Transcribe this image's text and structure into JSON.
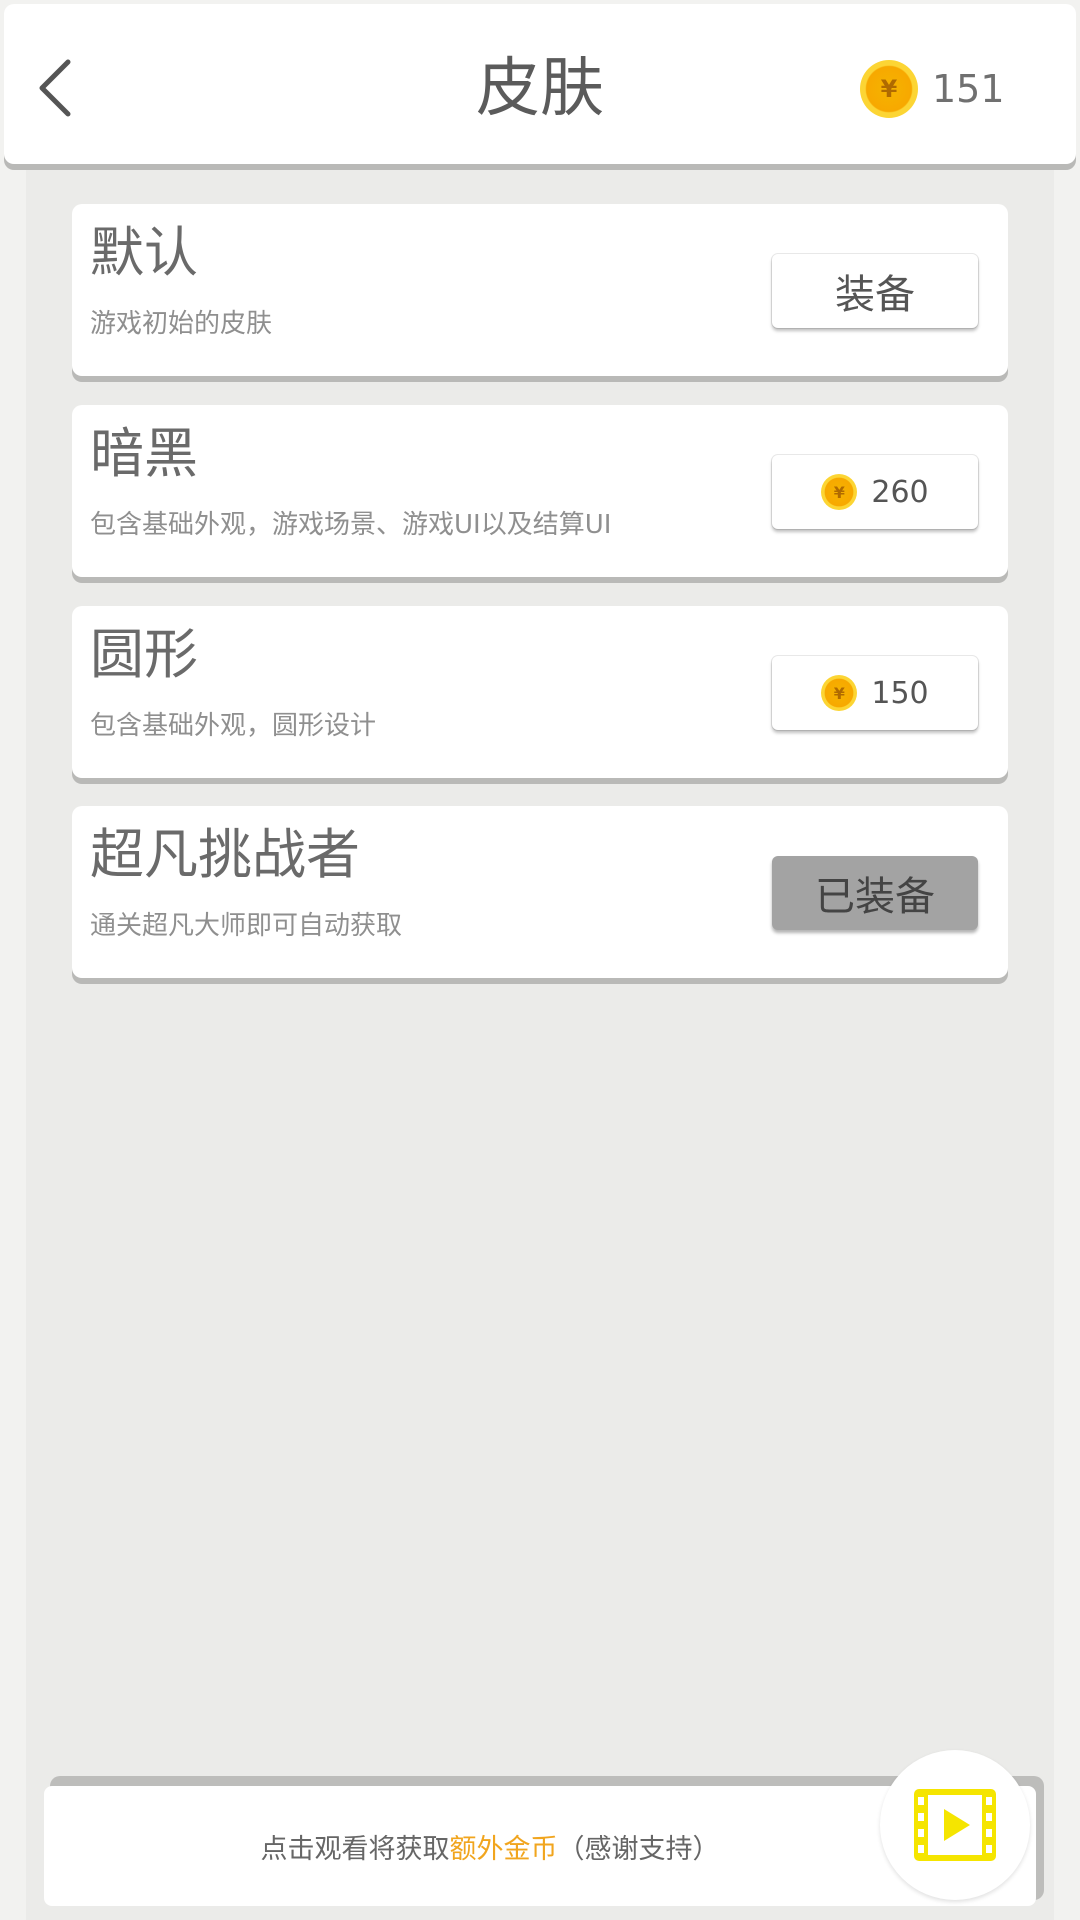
{
  "header": {
    "title": "皮肤",
    "coins": "151"
  },
  "skins": [
    {
      "name": "默认",
      "desc": "游戏初始的皮肤",
      "action": "装备"
    },
    {
      "name": "暗黑",
      "desc": "包含基础外观，游戏场景、游戏UI以及结算UI",
      "price": "260"
    },
    {
      "name": "圆形",
      "desc": "包含基础外观，圆形设计",
      "price": "150"
    },
    {
      "name": "超凡挑战者",
      "desc": "通关超凡大师即可自动获取",
      "action": "已装备"
    }
  ],
  "coin_symbol": "¥",
  "banner": {
    "text_before": "点击观看将获取",
    "highlight": "额外金币",
    "text_after": "（感谢支持）"
  },
  "colors": {
    "accent": "#f1a51e",
    "coin": "#f7a800",
    "video_icon": "#f5e500",
    "equipped_bg": "#a3a3a3"
  }
}
